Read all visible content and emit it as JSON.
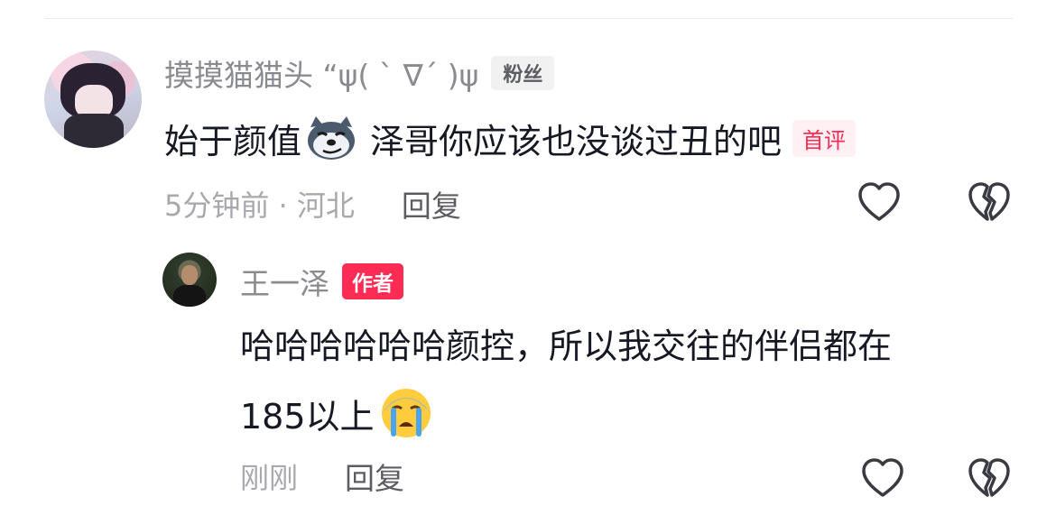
{
  "comment": {
    "username": "摸摸猫猫头 “ψ( ˋ ∇ˊ )ψ",
    "fan_badge": "粉丝",
    "text_before_emoji": "始于颜值",
    "text_after_emoji": "泽哥你应该也没谈过丑的吧",
    "first_badge": "首评",
    "time_location": "5分钟前 · 河北",
    "reply_label": "回复"
  },
  "reply": {
    "username": "王一泽",
    "author_badge": "作者",
    "line1": "哈哈哈哈哈哈颜控，所以我交往的伴侣都在",
    "line2": "185以上",
    "time": "刚刚",
    "reply_label": "回复"
  },
  "icons": {
    "like": "heart-outline-icon",
    "dislike": "broken-heart-icon",
    "emoji_dog": "dog-smirk-emoji-icon",
    "emoji_cry": "loudly-crying-emoji-icon"
  },
  "colors": {
    "accent": "#fe2c55",
    "meta_text": "#a8a9ae",
    "username_text": "#8a8b91"
  }
}
